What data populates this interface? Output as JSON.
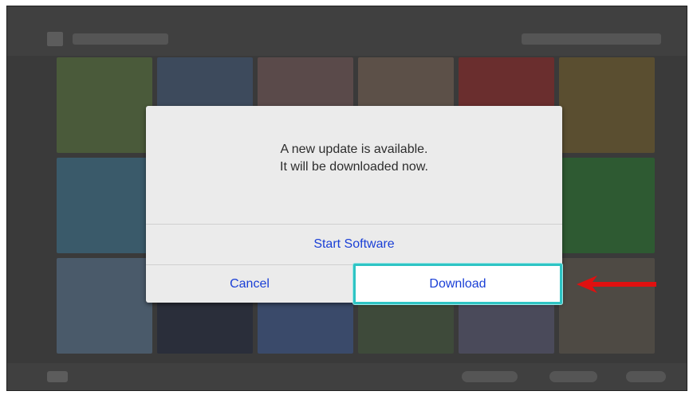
{
  "dialog": {
    "message_line1": "A new update is available.",
    "message_line2": "It will be downloaded now.",
    "start_software_label": "Start Software",
    "cancel_label": "Cancel",
    "download_label": "Download"
  },
  "colors": {
    "button_text": "#1a3fd6",
    "focus_ring": "#2ec4c4",
    "annotation_arrow": "#e01010",
    "dialog_bg": "#ebebeb",
    "dim_overlay": "#3a3a3a"
  },
  "icons": {
    "home": "home-icon",
    "controller": "controller-icon",
    "annotation": "red-arrow-icon"
  }
}
